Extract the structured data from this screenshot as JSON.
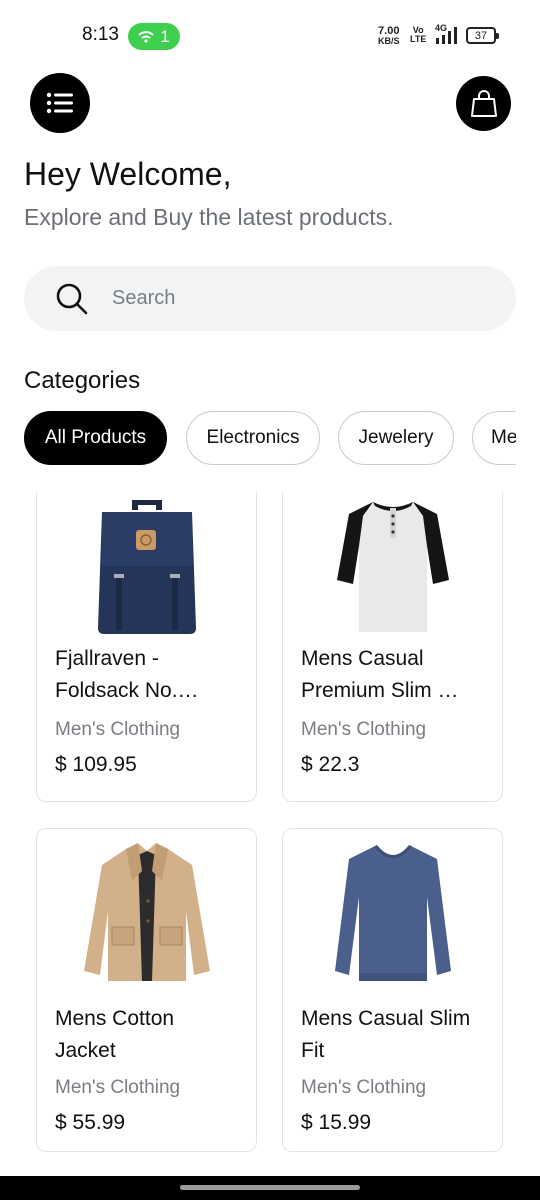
{
  "status_bar": {
    "time": "8:13",
    "hotspot_count": "1",
    "net_speed_value": "7.00",
    "net_speed_unit": "KB/S",
    "volte_top": "Vo",
    "volte_bottom": "LTE",
    "network": "4G",
    "battery": "37"
  },
  "header": {
    "menu_icon": "menu-list-icon",
    "bag_icon": "shopping-bag-icon",
    "title": "Hey Welcome,",
    "subtitle": "Explore and Buy the latest products."
  },
  "search": {
    "placeholder": "Search",
    "value": ""
  },
  "categories": {
    "title": "Categories",
    "items": [
      {
        "label": "All Products",
        "active": true
      },
      {
        "label": "Electronics",
        "active": false
      },
      {
        "label": "Jewelery",
        "active": false
      },
      {
        "label": "Me",
        "active": false
      }
    ]
  },
  "products": [
    {
      "name_line1": "Fjallraven -",
      "name_line2": "Foldsack No.…",
      "category": "Men's Clothing",
      "price": "$ 109.95",
      "image": "backpack-image"
    },
    {
      "name_line1": "Mens Casual",
      "name_line2": "Premium Slim …",
      "category": "Men's Clothing",
      "price": "$ 22.3",
      "image": "tshirt-image"
    },
    {
      "name_line1": "Mens Cotton",
      "name_line2": "Jacket",
      "category": "Men's Clothing",
      "price": "$ 55.99",
      "image": "jacket-image"
    },
    {
      "name_line1": "Mens Casual Slim",
      "name_line2": "Fit",
      "category": "Men's Clothing",
      "price": "$ 15.99",
      "image": "sweater-image"
    }
  ],
  "colors": {
    "accent": "#000000",
    "hotspot_green": "#3ecf4f",
    "search_bg": "#f2f3f5",
    "muted_text": "#7a7d83"
  }
}
